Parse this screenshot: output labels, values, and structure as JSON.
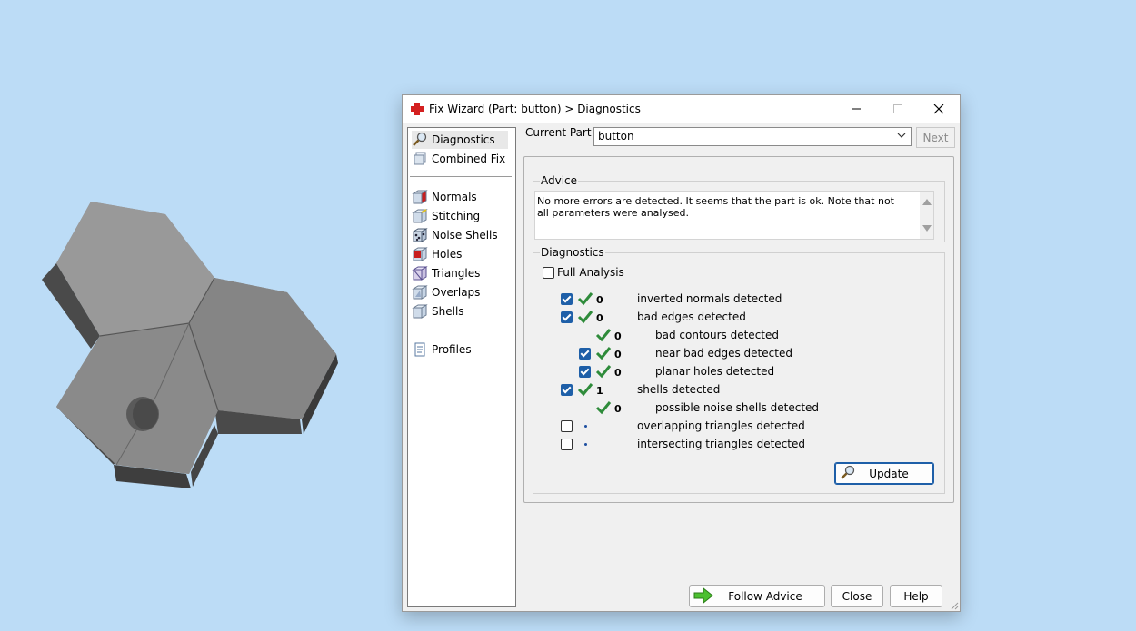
{
  "window": {
    "title": "Fix Wizard (Part: button) > Diagnostics",
    "minimize_glyph": "—",
    "maximize_glyph": "☐",
    "close_glyph": "✕"
  },
  "sidebar": {
    "items": [
      {
        "label": "Diagnostics",
        "icon": "magnifier-icon",
        "active": true
      },
      {
        "label": "Combined Fix",
        "icon": "cube-stack-icon"
      },
      {
        "label": "Normals",
        "icon": "normals-cube-icon"
      },
      {
        "label": "Stitching",
        "icon": "stitching-cube-icon"
      },
      {
        "label": "Noise Shells",
        "icon": "noise-shells-icon"
      },
      {
        "label": "Holes",
        "icon": "holes-cube-icon"
      },
      {
        "label": "Triangles",
        "icon": "triangles-cube-icon"
      },
      {
        "label": "Overlaps",
        "icon": "overlaps-cube-icon"
      },
      {
        "label": "Shells",
        "icon": "shells-cube-icon"
      },
      {
        "label": "Profiles",
        "icon": "document-icon"
      }
    ]
  },
  "part": {
    "label": "Current Part:",
    "value": "button",
    "next_label": "Next"
  },
  "advice": {
    "title": "Advice",
    "text": "No more errors are detected. It seems that the part is ok. Note that not all parameters were analysed."
  },
  "diagnostics": {
    "title": "Diagnostics",
    "full_analysis_label": "Full Analysis",
    "full_analysis_checked": false,
    "rows": [
      {
        "checked": true,
        "status": "ok",
        "count": "0",
        "label": "inverted normals detected",
        "indent": 0
      },
      {
        "checked": true,
        "status": "ok",
        "count": "0",
        "label": "bad edges detected",
        "indent": 0
      },
      {
        "checked": null,
        "status": "ok",
        "count": "0",
        "label": "bad contours detected",
        "indent": 1
      },
      {
        "checked": true,
        "status": "ok",
        "count": "0",
        "label": "near bad edges detected",
        "indent": 1
      },
      {
        "checked": true,
        "status": "ok",
        "count": "0",
        "label": "planar holes detected",
        "indent": 1
      },
      {
        "checked": true,
        "status": "ok",
        "count": "1",
        "label": "shells detected",
        "indent": 0
      },
      {
        "checked": null,
        "status": "ok",
        "count": "0",
        "label": "possible noise shells detected",
        "indent": 1
      },
      {
        "checked": false,
        "status": "pending",
        "count": "",
        "label": "overlapping triangles detected",
        "indent": 0
      },
      {
        "checked": false,
        "status": "pending",
        "count": "",
        "label": "intersecting triangles detected",
        "indent": 0
      }
    ],
    "update_label": "Update"
  },
  "footer": {
    "follow_advice_label": "Follow Advice",
    "close_label": "Close",
    "help_label": "Help"
  },
  "colors": {
    "background": "#bcdcf6",
    "accent": "#1e5fa8",
    "ok_green": "#2e8b3a",
    "model_grey": "#8f8f8f"
  }
}
